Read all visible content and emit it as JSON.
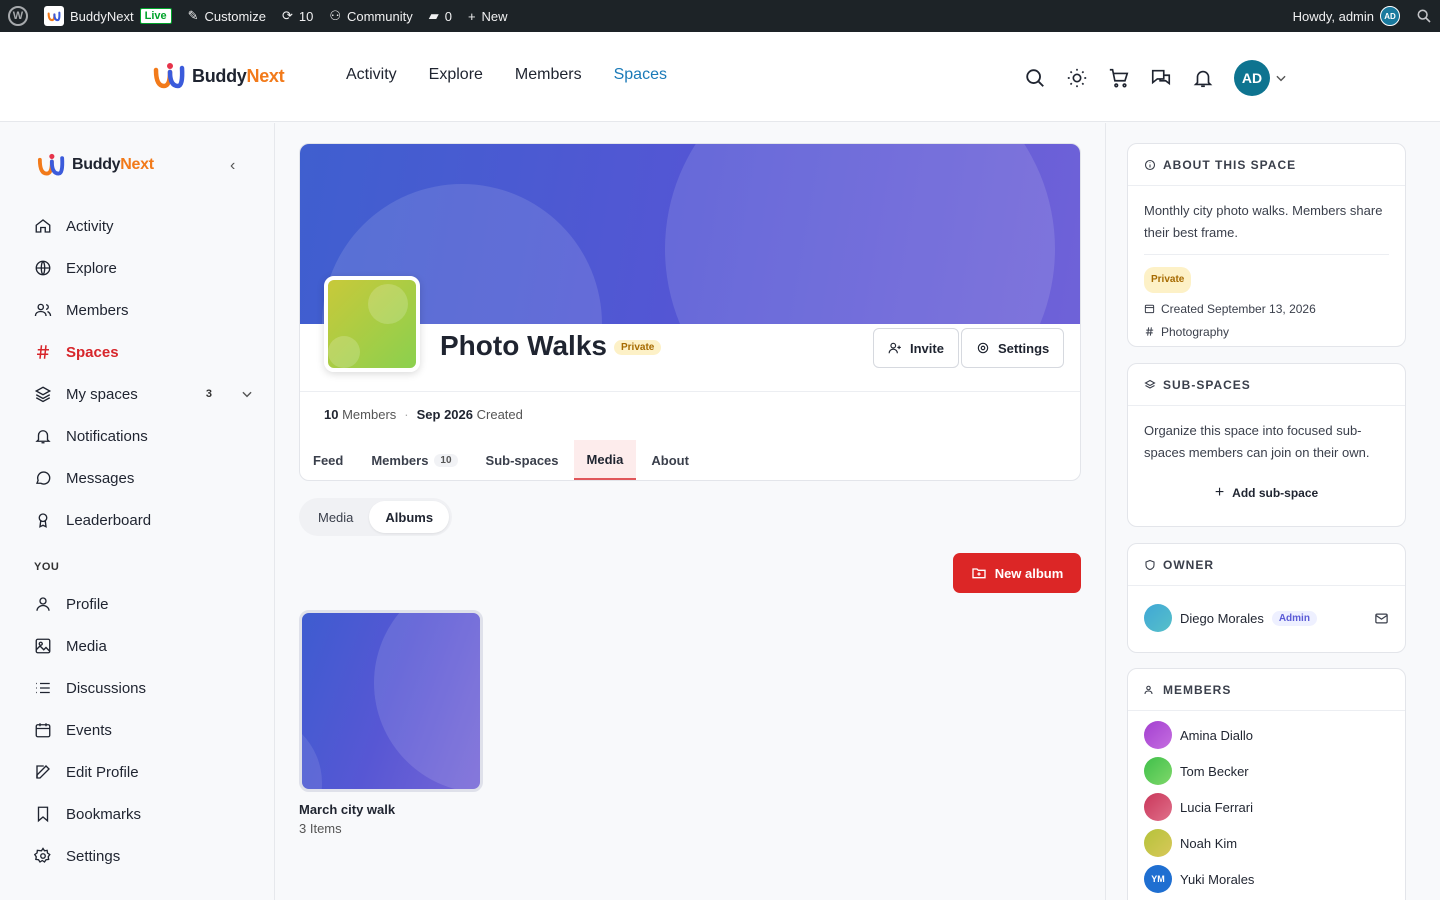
{
  "adminbar": {
    "site_name": "BuddyNext",
    "live_label": "Live",
    "customize_label": "Customize",
    "updates_count": "10",
    "community_label": "Community",
    "comments_count": "0",
    "new_label": "New",
    "howdy": "Howdy, admin",
    "avatar_initials": "AD"
  },
  "brand": {
    "part1": "Buddy",
    "part2": "Next"
  },
  "topnav": {
    "items": [
      {
        "label": "Activity"
      },
      {
        "label": "Explore"
      },
      {
        "label": "Members"
      },
      {
        "label": "Spaces",
        "active": true
      }
    ],
    "avatar_initials": "AD"
  },
  "sidebar": {
    "items": [
      {
        "label": "Activity",
        "icon": "home-icon"
      },
      {
        "label": "Explore",
        "icon": "globe-icon"
      },
      {
        "label": "Members",
        "icon": "users-icon"
      },
      {
        "label": "Spaces",
        "icon": "hash-icon",
        "active": true
      },
      {
        "label": "My spaces",
        "icon": "layers-icon",
        "count": "3"
      },
      {
        "label": "Notifications",
        "icon": "bell-icon"
      },
      {
        "label": "Messages",
        "icon": "chat-icon"
      },
      {
        "label": "Leaderboard",
        "icon": "award-icon"
      }
    ],
    "you_label": "YOU",
    "you_items": [
      {
        "label": "Profile",
        "icon": "user-icon"
      },
      {
        "label": "Media",
        "icon": "image-icon"
      },
      {
        "label": "Discussions",
        "icon": "list-icon"
      },
      {
        "label": "Events",
        "icon": "calendar-icon"
      },
      {
        "label": "Edit Profile",
        "icon": "edit-icon"
      },
      {
        "label": "Bookmarks",
        "icon": "bookmark-icon"
      },
      {
        "label": "Settings",
        "icon": "gear-icon"
      }
    ]
  },
  "space": {
    "title": "Photo Walks",
    "privacy": "Private",
    "invite_label": "Invite",
    "settings_label": "Settings",
    "members_count": "10",
    "members_word": "Members",
    "created_date": "Sep 2026",
    "created_word": "Created",
    "tabs": [
      {
        "label": "Feed"
      },
      {
        "label": "Members",
        "count": "10"
      },
      {
        "label": "Sub-spaces"
      },
      {
        "label": "Media",
        "active": true
      },
      {
        "label": "About"
      }
    ]
  },
  "media": {
    "seg_media": "Media",
    "seg_albums": "Albums",
    "new_album_label": "New album",
    "albums": [
      {
        "name": "March city walk",
        "count": "3 Items"
      }
    ]
  },
  "about": {
    "heading": "ABOUT THIS SPACE",
    "description": "Monthly city photo walks. Members share their best frame.",
    "privacy": "Private",
    "created": "Created September 13, 2026",
    "category": "Photography"
  },
  "subspaces": {
    "heading": "SUB-SPACES",
    "description": "Organize this space into focused sub-spaces members can join on their own.",
    "add_label": "Add sub-space"
  },
  "owner": {
    "heading": "OWNER",
    "name": "Diego Morales",
    "role": "Admin"
  },
  "members": {
    "heading": "MEMBERS",
    "list": [
      {
        "name": "Amina Diallo",
        "color": "#a33fd0"
      },
      {
        "name": "Tom Becker",
        "color": "#3fbf4a"
      },
      {
        "name": "Lucia Ferrari",
        "color": "#c9365a"
      },
      {
        "name": "Noah Kim",
        "color": "#b5c23a"
      },
      {
        "name": "Yuki Morales",
        "color": "#1f6fd1",
        "initials": "YM"
      }
    ]
  },
  "colors": {
    "accent_red": "#dc2626",
    "link_blue": "#1a7ab8",
    "avatar_teal": "#0e7490"
  }
}
